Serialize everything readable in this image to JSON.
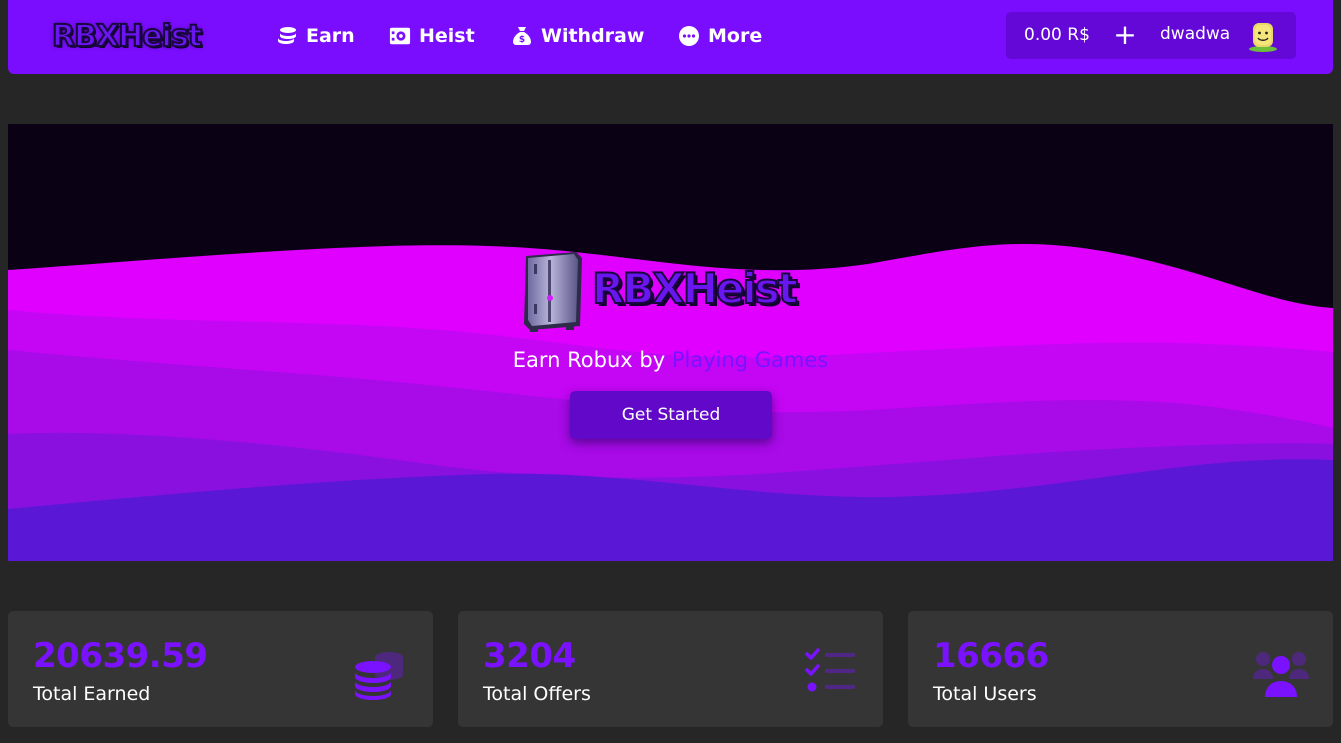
{
  "brand": {
    "name": "RBXHeist"
  },
  "nav": {
    "items": [
      {
        "label": "Earn",
        "icon": "coins-icon"
      },
      {
        "label": "Heist",
        "icon": "vault-icon"
      },
      {
        "label": "Withdraw",
        "icon": "money-bag-icon"
      },
      {
        "label": "More",
        "icon": "ellipsis-circle-icon"
      }
    ]
  },
  "user": {
    "balance": "0.00 R$",
    "add_label": "+",
    "username": "dwadwa",
    "avatar_icon": "avatar-icon"
  },
  "hero": {
    "tagline_prefix": "Earn Robux by ",
    "tagline_highlight": "Playing Games",
    "cta_label": "Get Started"
  },
  "stats": [
    {
      "value": "20639.59",
      "label": "Total Earned",
      "icon": "coins-stack-icon"
    },
    {
      "value": "3204",
      "label": "Total Offers",
      "icon": "checklist-icon"
    },
    {
      "value": "16666",
      "label": "Total Users",
      "icon": "users-icon"
    }
  ],
  "colors": {
    "accent": "#7a0dfd",
    "highlight": "#7a12ff",
    "background": "#262626",
    "card": "#353535"
  }
}
